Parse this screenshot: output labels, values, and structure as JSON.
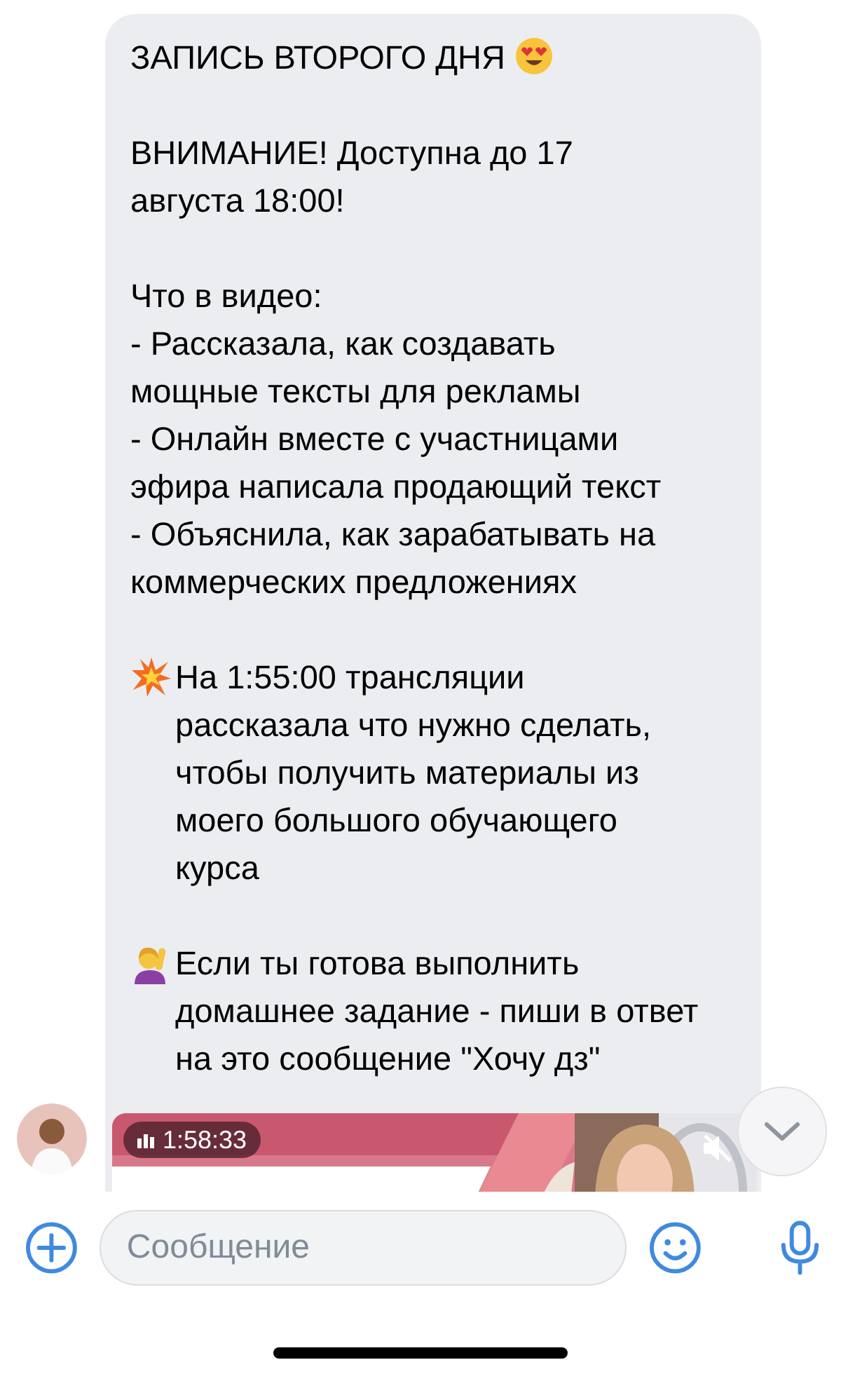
{
  "message": {
    "paragraphs": [
      {
        "text": "ЗАПИСЬ ВТОРОГО ДНЯ",
        "kind": "icon-after"
      },
      {
        "text": "ВНИМАНИЕ! Доступна до 17\nавгуста 18:00!",
        "kind": "plain"
      },
      {
        "text": "Что в видео:\n- Рассказала, как создавать\nмощные тексты для рекламы\n- Онлайн вместе с участницами\nэфира написала продающий текст\n- Объяснила, как зарабатывать на\nкоммерческих предложениях",
        "kind": "plain"
      },
      {
        "text": "На 1:55:00 трансляции\nрассказала что нужно сделать,\nчтобы получить материалы из\nмоего большого обучающего\nкурса",
        "kind": "icon-before"
      },
      {
        "text": "Если ты готова выполнить\nдомашнее задание - пиши в ответ\nна это сообщение \"Хочу дз\"",
        "kind": "icon-before"
      }
    ],
    "video": {
      "kind": "picture",
      "duration": "1:58:33"
    }
  },
  "composer": {
    "placeholder": "Сообщение"
  }
}
